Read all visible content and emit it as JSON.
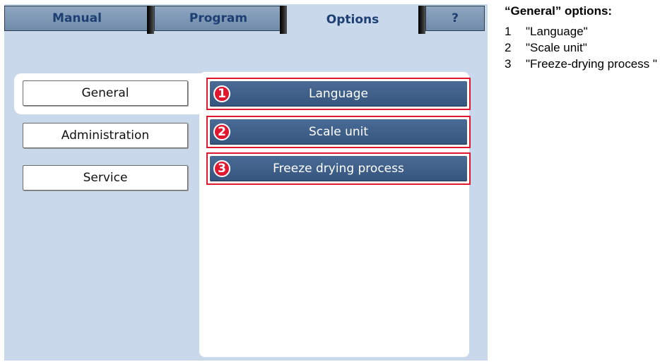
{
  "tabs": [
    {
      "label": "Manual",
      "active": false
    },
    {
      "label": "Program",
      "active": false
    },
    {
      "label": "Options",
      "active": true
    },
    {
      "label": "?",
      "active": false
    }
  ],
  "sidebar": {
    "items": [
      {
        "label": "General",
        "selected": true
      },
      {
        "label": "Administration",
        "selected": false
      },
      {
        "label": "Service",
        "selected": false
      }
    ]
  },
  "options": [
    {
      "callout": "1",
      "label": "Language"
    },
    {
      "callout": "2",
      "label": "Scale unit"
    },
    {
      "callout": "3",
      "label": "Freeze drying process"
    }
  ],
  "legend": {
    "title": "“General” options:",
    "items": [
      {
        "num": "1",
        "text": "\"Language\""
      },
      {
        "num": "2",
        "text": "\"Scale unit\""
      },
      {
        "num": "3",
        "text": "\"Freeze-drying process \""
      }
    ]
  },
  "colors": {
    "screen_bg": "#c9d8ea",
    "tab_text": "#1d3f73",
    "option_button": "#3f6089",
    "callout_red": "#e0182f"
  }
}
